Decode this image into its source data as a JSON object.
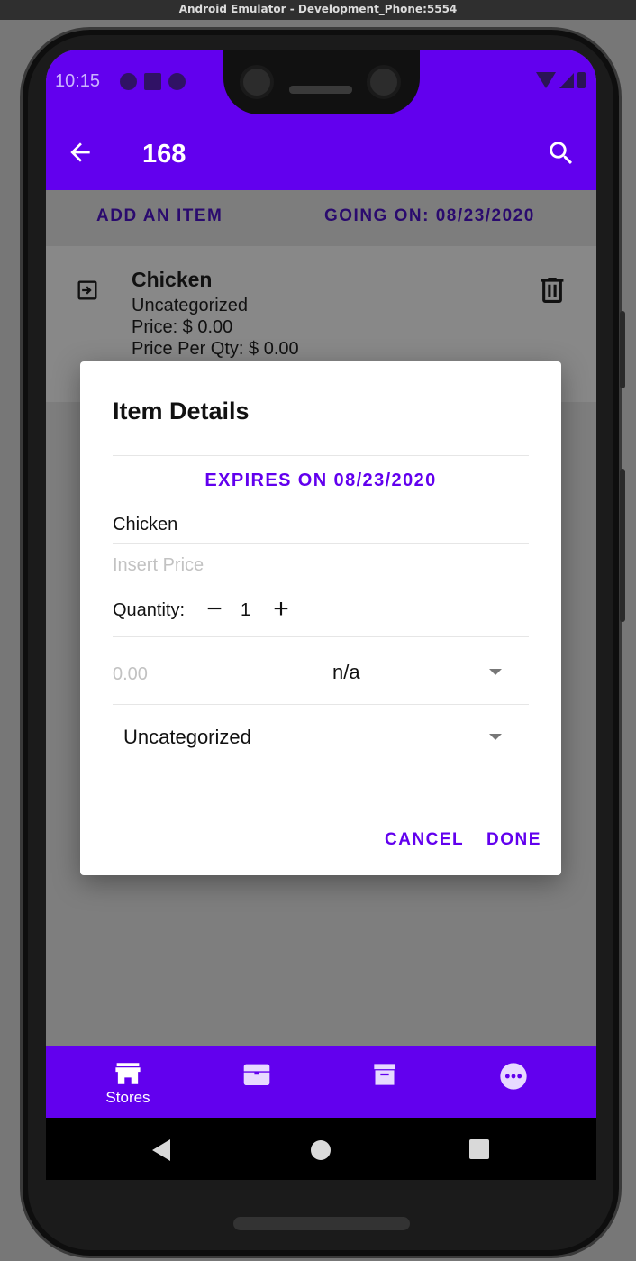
{
  "window": {
    "title": "Android Emulator - Development_Phone:5554"
  },
  "status_bar": {
    "time": "10:15"
  },
  "app_bar": {
    "title": "168",
    "back_icon": "arrow-back-icon",
    "search_icon": "search-icon"
  },
  "actions": {
    "add_item": "ADD AN ITEM",
    "going_on": "GOING ON: 08/23/2020"
  },
  "list": {
    "items": [
      {
        "title": "Chicken",
        "category": "Uncategorized",
        "price": "Price: $ 0.00",
        "price_per_qty": "Price Per Qty: $ 0.00"
      }
    ]
  },
  "dialog": {
    "title": "Item Details",
    "expires": "EXPIRES ON 08/23/2020",
    "name": "Chicken",
    "price_placeholder": "Insert Price",
    "quantity_label": "Quantity:",
    "quantity_minus": "−",
    "quantity_value": "1",
    "quantity_plus": "+",
    "unit_price_placeholder": "0.00",
    "unit_selected": "n/a",
    "category_selected": "Uncategorized",
    "cancel": "CANCEL",
    "done": "DONE"
  },
  "bottom_nav": {
    "items": [
      {
        "label": "Stores",
        "icon": "store-icon"
      },
      {
        "label": "",
        "icon": "inventory-chest-icon"
      },
      {
        "label": "",
        "icon": "archive-icon"
      },
      {
        "label": "",
        "icon": "more-horizontal-icon"
      }
    ]
  },
  "colors": {
    "primary": "#6200ee",
    "surface": "#ffffff",
    "scrim": "#7e7e7e"
  }
}
